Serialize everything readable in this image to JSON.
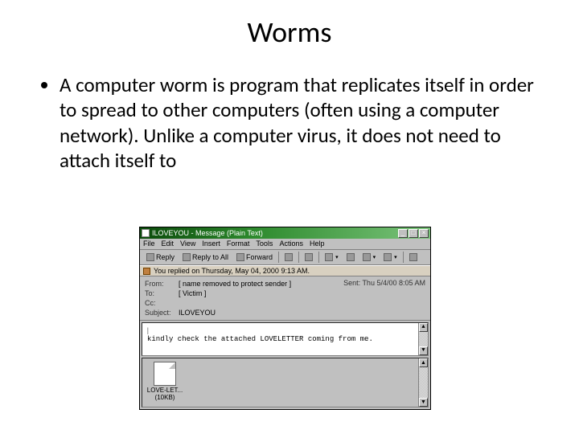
{
  "slide": {
    "title": "Worms",
    "bullet": "A computer worm is program that replicates itself in order to spread to other computers (often using a computer network). Unlike a computer virus, it does not need to attach itself to"
  },
  "email": {
    "titlebar": "ILOVEYOU - Message (Plain Text)",
    "buttons": {
      "min": "_",
      "max": "□",
      "close": "×"
    },
    "menu": {
      "file": "File",
      "edit": "Edit",
      "view": "View",
      "insert": "Insert",
      "format": "Format",
      "tools": "Tools",
      "actions": "Actions",
      "help": "Help"
    },
    "toolbar": {
      "reply": "Reply",
      "reply_all": "Reply to All",
      "forward": "Forward"
    },
    "info_bar": "You replied on Thursday, May 04, 2000 9:13 AM.",
    "headers": {
      "from_label": "From:",
      "from_value": "[ name removed to protect sender ]",
      "to_label": "To:",
      "to_value": "[ Victim ]",
      "cc_label": "Cc:",
      "cc_value": "",
      "subject_label": "Subject:",
      "subject_value": "ILOVEYOU",
      "sent_label": "Sent:",
      "sent_value": "Thu 5/4/00 8:05 AM"
    },
    "body_cursor": "|",
    "body_text": "kindly check the attached LOVELETTER coming from me.",
    "attachment": {
      "name_line1": "LOVE-LET...",
      "name_line2": "(10KB)"
    },
    "scroll": {
      "up": "▲",
      "down": "▼"
    }
  }
}
